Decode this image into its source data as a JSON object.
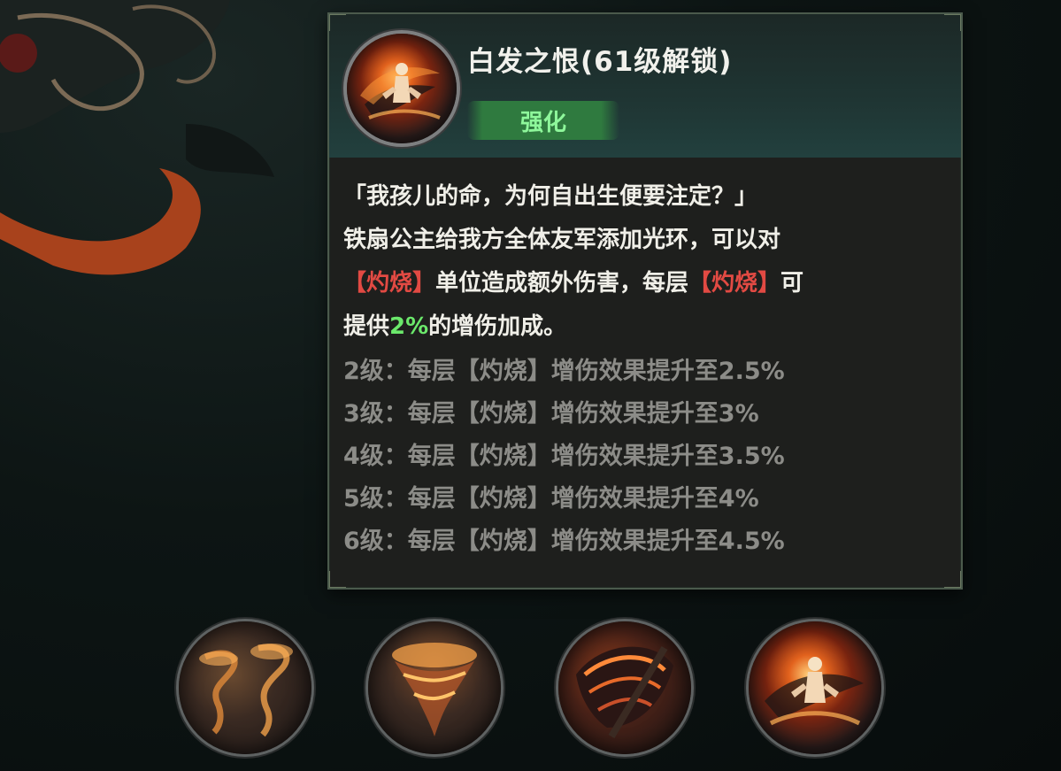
{
  "tooltip": {
    "title": "白发之恨(61级解锁)",
    "tag": "强化",
    "skill_icon": "princess-fire-icon",
    "description": {
      "line1": "「我孩儿的命，为何自出生便要注定？」",
      "line2": "铁扇公主给我方全体友军添加光环，可以对",
      "line3_burn1": "【灼烧】",
      "line3_mid": "单位造成额外伤害，每层",
      "line3_burn2": "【灼烧】",
      "line3_end": "可",
      "line4_pre": "提供",
      "line4_value": "2%",
      "line4_post": "的增伤加成。"
    },
    "levels": [
      "2级：每层【灼烧】增伤效果提升至2.5%",
      "3级：每层【灼烧】增伤效果提升至3%",
      "4级：每层【灼烧】增伤效果提升至3.5%",
      "5级：每层【灼烧】增伤效果提升至4%",
      "6级：每层【灼烧】增伤效果提升至4.5%"
    ]
  },
  "skills": [
    {
      "icon": "twin-tornado-icon"
    },
    {
      "icon": "fire-tornado-icon"
    },
    {
      "icon": "palm-fan-icon"
    },
    {
      "icon": "princess-fire-icon"
    }
  ],
  "colors": {
    "burn": "#e24a43",
    "highlight": "#6be86b",
    "tag_text": "#8ef79b",
    "level_text": "#8c8c88"
  }
}
